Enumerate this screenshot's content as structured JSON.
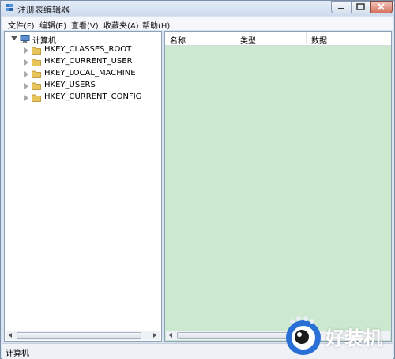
{
  "window": {
    "title": "注册表编辑器"
  },
  "menu": {
    "items": [
      "文件(F)",
      "编辑(E)",
      "查看(V)",
      "收藏夹(A)",
      "帮助(H)"
    ]
  },
  "tree": {
    "root": "计算机",
    "children": [
      "HKEY_CLASSES_ROOT",
      "HKEY_CURRENT_USER",
      "HKEY_LOCAL_MACHINE",
      "HKEY_USERS",
      "HKEY_CURRENT_CONFIG"
    ]
  },
  "columns": {
    "name": "名称",
    "type": "类型",
    "data": "数据"
  },
  "status": {
    "path": "计算机"
  },
  "watermark": {
    "text": "好装机"
  },
  "colors": {
    "value_pane_bg": "#cce8cf",
    "folder": "#e8c55a",
    "title_bar": "#dbe6f4"
  }
}
